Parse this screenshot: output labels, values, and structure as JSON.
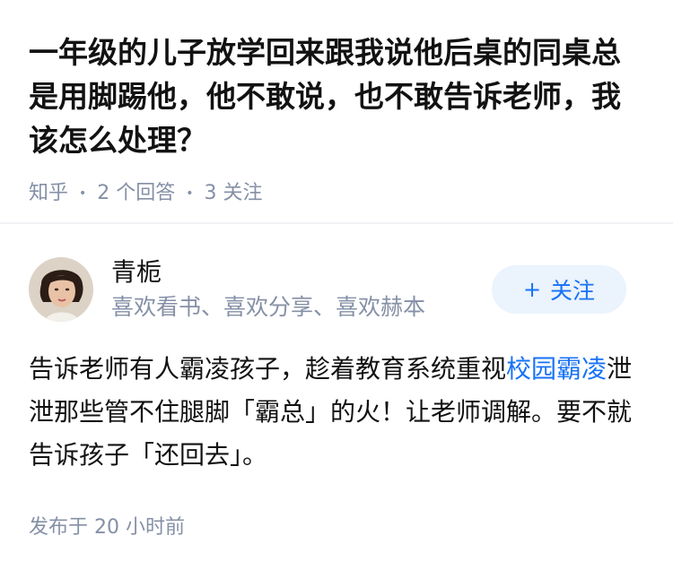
{
  "question": {
    "title": "一年级的儿子放学回来跟我说他后桌的同桌总是用脚踢他，他不敢说，也不敢告诉老师，我该怎么处理？",
    "source": "知乎",
    "answer_count": "2 个回答",
    "follower_count": "3 关注"
  },
  "answer": {
    "author_name": "青栀",
    "author_bio": "喜欢看书、喜欢分享、喜欢赫本",
    "follow_label": "关注",
    "body_part1": "告诉老师有人霸凌孩子，趁着教育系统重视",
    "body_link": "校园霸凌",
    "body_part2": "泄泄那些管不住腿脚「霸总」的火！让老师调解。要不就告诉孩子「还回去」。",
    "time": "发布于  20 小时前"
  },
  "colors": {
    "link": "#1772f6",
    "meta_gray": "#8590a6",
    "follow_bg": "#ebf3fc"
  }
}
